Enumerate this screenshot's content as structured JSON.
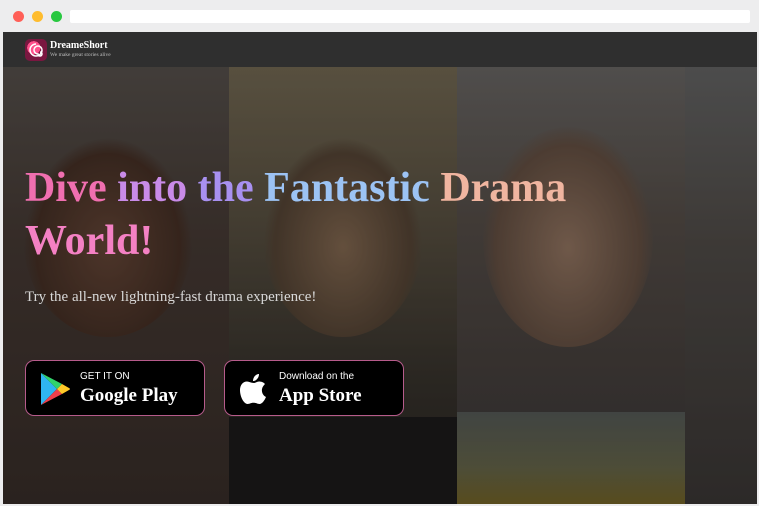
{
  "site": {
    "brand_name": "DreameShort",
    "tagline": "We make great stories alive"
  },
  "hero": {
    "title_words": [
      "Dive",
      "into",
      "the",
      "Fantastic",
      "Drama",
      "World!"
    ],
    "subtitle": "Try the all-new lightning-fast drama experience!"
  },
  "buttons": {
    "google_play": {
      "small": "GET IT ON",
      "big": "Google Play",
      "icon": "google-play-icon"
    },
    "app_store": {
      "small": "Download on the",
      "big": "App Store",
      "icon": "apple-icon"
    }
  },
  "colors": {
    "page_bg": "#2c2c2c",
    "button_border": "#b65b8b",
    "title_gradient": [
      "#f06fb0",
      "#c98be8",
      "#a890f0",
      "#9cc3f4",
      "#a6e3b4",
      "#f0b5a0",
      "#ff5f8e"
    ]
  }
}
